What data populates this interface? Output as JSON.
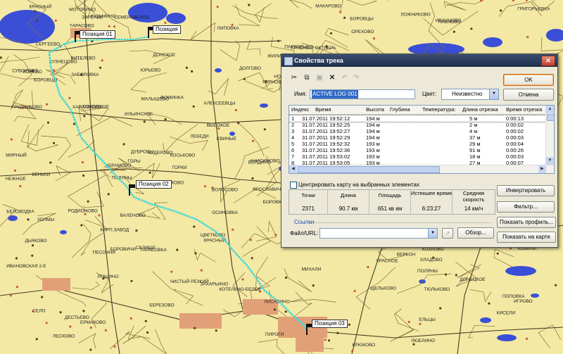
{
  "map": {
    "positions": [
      {
        "label": "Позиция 01"
      },
      {
        "label": "Позиция"
      },
      {
        "label": "Позиция 02"
      },
      {
        "label": "Позиция 03"
      }
    ],
    "places": [
      "ВЕРКОН",
      "КРАСНЫЙ",
      "КИРП.ЗАВОД",
      "ДУБРОВЫ",
      "ЛИСАВИНО",
      "КИСЕЛИ",
      "ПЕТРОВО",
      "АБРАМОВО",
      "КОНЕВО",
      "ИВАНЦОВО",
      "ГОРКИ",
      "МОТОРИНО",
      "КОЗЛОВО",
      "БОРОВИЧИ",
      "СЕМЕНОВСКОЕ",
      "КРАСНЫЙ ОКТЯБРЬ",
      "ВЫСОКОЕ",
      "КОСЬКОВО",
      "ОРЕХОВО",
      "КРЮКОВО",
      "КАЗАКОВО",
      "АЛЕКСЕЕВЦЫ",
      "ЛЕСКОВО",
      "ИЛЬИНСКОЕ",
      "ТАРАСОВО",
      "ДОЛГОВО",
      "ЗАРЕЧЬЕ",
      "АНИСИМОВО",
      "СУВОРОВО",
      "ГОРНОВО",
      "ТАРАСОВКА",
      "СЕРГЕЕВО",
      "ПИРОГИ",
      "СОКОЛИЩЕ",
      "ЧИСТЫЙ РЕЗКИЙ",
      "БОРОВКИ",
      "ЯРОСЛАВИЧИ",
      "РОДИОНОВО",
      "МИХАЛИ",
      "ТЮЛЬКОВО",
      "ПОЛЯНЫ",
      "ЩЕЛЬКОВО",
      "ЛОЖНИКОВО",
      "ВОЛОСОВО",
      "ЕРМАКОВО",
      "ВЕНЬКИ",
      "ХЛАДОВО",
      "БОЛДИНО",
      "НЕЖНОЕ",
      "ФОМИНКА",
      "ИВАНОВСКАЯ 2-Е",
      "ГОРЫ",
      "КУЗНЕЦОВО",
      "ПОЛЯНЫ",
      "КРАСНЫЙ",
      "ВИТЕЛЕВО",
      "ВАЛЕНОВО",
      "ДЬЯКОВО",
      "КУДЕРОВО",
      "МИРНЫЙ",
      "ПЕСОЧНЯ",
      "ДЕСТЬЕВО",
      "ЛЕБЕДИ",
      "СЕЛО",
      "БОРОВЦЫ",
      "МАЛЫШЕВО",
      "ПОПОВКА",
      "ЗАБОРОВКА",
      "ОСИНОВКА",
      "ЛИПОВКА",
      "ГРИГОРЬЕВКА",
      "СЕЛИЩЕ",
      "СВИНЫЕ",
      "КУЗЬМИНО",
      "ДОНЕЦКОЕ",
      "ДОНСКОЕ",
      "БЕЛОВОДКА",
      "ЦВЕТКОВО",
      "ПАВЛОВО",
      "ГРУДНИКОВО",
      "КОВАЛИ",
      "ЕЛЬЦЫ",
      "КРАСНОЕ",
      "ЮРЬЕВО",
      "МАКАРОВО",
      "РОЩИНО",
      "ПАРКОВЫЕ",
      "КОТЕЛЬНО-БЕЛОЕ",
      "ЖИЛИНО",
      "ХОЛМЫ",
      "БЕРЕЗОВО",
      "НОВОЕ",
      "ИГРОВО",
      "ЗАХАРЬИНО",
      "БОРОВЦЫ",
      "ХАРЛАМОВО",
      "ЛЮБЛИНО"
    ]
  },
  "dialog": {
    "title": "Свойства трека",
    "close": "✕",
    "toolbar": {
      "cut": "✂",
      "copy": "⧉",
      "paste": "▣",
      "delete": "✕",
      "undo": "↶",
      "redo": "↷"
    },
    "name_label": "Имя:",
    "name_value": "ACTIVE LOG 001",
    "color_label": "Цвет:",
    "color_value": "Неизвестно",
    "ok": "OK",
    "cancel": "Отмена",
    "table": {
      "headers": [
        "Индекс",
        "Время",
        "Высота",
        "Глубина",
        "Температура:",
        "Длина отрезка",
        "Время отрезка"
      ],
      "rows": [
        [
          "1",
          "31.07.2011 19:52:12",
          "194 м",
          "",
          "",
          "5 м",
          "0:00:13"
        ],
        [
          "2",
          "31.07.2011 19:52:25",
          "194 м",
          "",
          "",
          "2 м",
          "0:00:02"
        ],
        [
          "3",
          "31.07.2011 19:52:27",
          "194 м",
          "",
          "",
          "4 м",
          "0:00:02"
        ],
        [
          "4",
          "31.07.2011 19:52:29",
          "194 м",
          "",
          "",
          "37 м",
          "0:00:03"
        ],
        [
          "5",
          "31.07.2011 19:52:32",
          "193 м",
          "",
          "",
          "29 м",
          "0:00:04"
        ],
        [
          "6",
          "31.07.2011 19:52:36",
          "193 м",
          "",
          "",
          "91 м",
          "0:00:26"
        ],
        [
          "7",
          "31.07.2011 19:53:02",
          "193 м",
          "",
          "",
          "18 м",
          "0:00:03"
        ],
        [
          "8",
          "31.07.2011 19:53:05",
          "193 м",
          "",
          "",
          "27 м",
          "0:00:07"
        ]
      ]
    },
    "center_checkbox": "Центрировать карту на выбранных элементах",
    "stats": [
      {
        "header": "Точки",
        "value": "2371"
      },
      {
        "header": "Длина",
        "value": "90.7 км"
      },
      {
        "header": "Площадь",
        "value": "651 кв км"
      },
      {
        "header": "Истекшее время",
        "value": "6:23:27"
      },
      {
        "header": "Средняя скорость",
        "value": "14 км/ч"
      }
    ],
    "invert": "Инвертировать",
    "filter": "Фильтр...",
    "links_label": "Ссылки",
    "file_label": "Файл/URL:",
    "file_value": "",
    "browse": "Обзор...",
    "show_profile": "Показать профиль...",
    "show_on_map": "Показать на карте",
    "colors": {
      "track": "#3fd7d7",
      "titlebar": "#2a3b5c",
      "link": "#0b47b0"
    }
  }
}
